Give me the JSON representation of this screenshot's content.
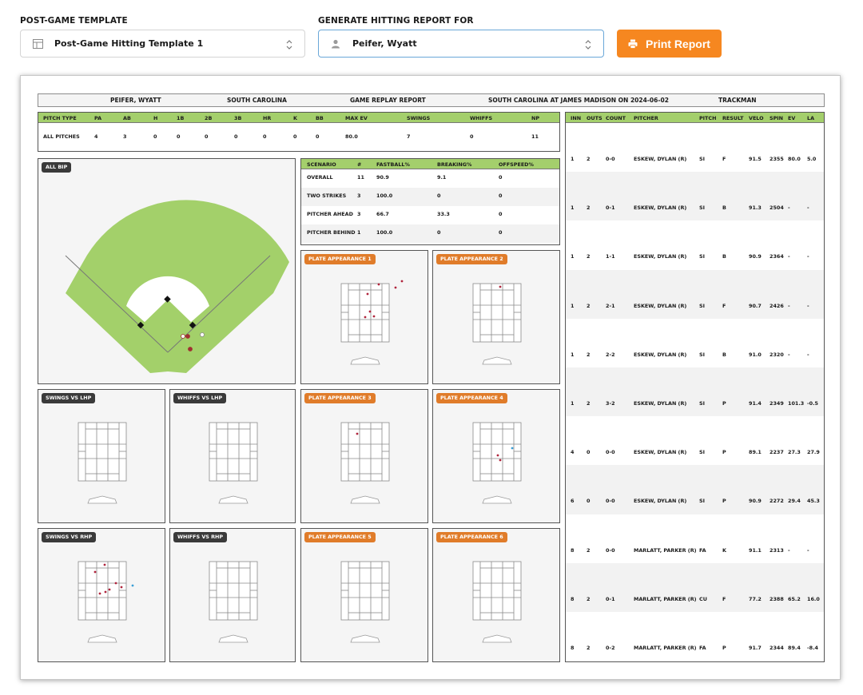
{
  "controls": {
    "template_label": "POST-GAME TEMPLATE",
    "template_value": "Post-Game Hitting Template 1",
    "report_for_label": "GENERATE HITTING REPORT FOR",
    "report_for_value": "Peifer, Wyatt",
    "print_label": "Print Report",
    "accent_color": "#f68720"
  },
  "header": {
    "player": "PEIFER, WYATT",
    "team": "SOUTH CAROLINA",
    "report": "GAME REPLAY REPORT",
    "game": "SOUTH CAROLINA AT JAMES MADISON ON 2024-06-02",
    "source": "TRACKMAN"
  },
  "stats": {
    "headers": [
      "PITCH TYPE",
      "PA",
      "AB",
      "H",
      "1B",
      "2B",
      "3B",
      "HR",
      "K",
      "BB",
      "MAX EV",
      "SWINGS",
      "WHIFFS",
      "NP"
    ],
    "row": [
      "ALL PITCHES",
      "4",
      "3",
      "0",
      "0",
      "0",
      "0",
      "0",
      "0",
      "0",
      "80.0",
      "7",
      "0",
      "11"
    ]
  },
  "scenario": {
    "headers": [
      "SCENARIO",
      "#",
      "FASTBALL%",
      "BREAKING%",
      "OFFSPEED%"
    ],
    "rows": [
      [
        "OVERALL",
        "11",
        "90.9",
        "9.1",
        "0"
      ],
      [
        "TWO STRIKES",
        "3",
        "100.0",
        "0",
        "0"
      ],
      [
        "PITCHER AHEAD",
        "3",
        "66.7",
        "33.3",
        "0"
      ],
      [
        "PITCHER BEHIND",
        "1",
        "100.0",
        "0",
        "0"
      ]
    ]
  },
  "panels": {
    "all_bip": "ALL BIP",
    "pa1": "PLATE APPEARANCE 1",
    "pa2": "PLATE APPEARANCE 2",
    "pa3": "PLATE APPEARANCE 3",
    "pa4": "PLATE APPEARANCE 4",
    "pa5": "PLATE APPEARANCE 5",
    "pa6": "PLATE APPEARANCE 6",
    "swings_lhp": "SWINGS VS LHP",
    "whiffs_lhp": "WHIFFS VS LHP",
    "swings_rhp": "SWINGS VS RHP",
    "whiffs_rhp": "WHIFFS VS RHP"
  },
  "pitches": {
    "headers": [
      "INN",
      "OUTS",
      "COUNT",
      "PITCHER",
      "PITCH",
      "RESULT",
      "VELO",
      "SPIN",
      "EV",
      "LA"
    ],
    "rows": [
      [
        "1",
        "2",
        "0-0",
        "ESKEW, DYLAN (R)",
        "SI",
        "F",
        "91.5",
        "2355",
        "80.0",
        "5.0"
      ],
      [
        "1",
        "2",
        "0-1",
        "ESKEW, DYLAN (R)",
        "SI",
        "B",
        "91.3",
        "2504",
        "-",
        "-"
      ],
      [
        "1",
        "2",
        "1-1",
        "ESKEW, DYLAN (R)",
        "SI",
        "B",
        "90.9",
        "2364",
        "-",
        "-"
      ],
      [
        "1",
        "2",
        "2-1",
        "ESKEW, DYLAN (R)",
        "SI",
        "F",
        "90.7",
        "2426",
        "-",
        "-"
      ],
      [
        "1",
        "2",
        "2-2",
        "ESKEW, DYLAN (R)",
        "SI",
        "B",
        "91.0",
        "2320",
        "-",
        "-"
      ],
      [
        "1",
        "2",
        "3-2",
        "ESKEW, DYLAN (R)",
        "SI",
        "P",
        "91.4",
        "2349",
        "101.3",
        "-0.5"
      ],
      [
        "4",
        "0",
        "0-0",
        "ESKEW, DYLAN (R)",
        "SI",
        "P",
        "89.1",
        "2237",
        "27.3",
        "27.9"
      ],
      [
        "6",
        "0",
        "0-0",
        "ESKEW, DYLAN (R)",
        "SI",
        "P",
        "90.9",
        "2272",
        "29.4",
        "45.3"
      ],
      [
        "8",
        "2",
        "0-0",
        "MARLATT, PARKER (R)",
        "FA",
        "K",
        "91.1",
        "2313",
        "-",
        "-"
      ],
      [
        "8",
        "2",
        "0-1",
        "MARLATT, PARKER (R)",
        "CU",
        "F",
        "77.2",
        "2388",
        "65.2",
        "16.0"
      ],
      [
        "8",
        "2",
        "0-2",
        "MARLATT, PARKER (R)",
        "FA",
        "P",
        "91.7",
        "2344",
        "89.4",
        "-8.4"
      ]
    ]
  },
  "colors": {
    "grass": "#a3d06a",
    "table_header": "#a4cf6c",
    "badge_orange": "#e07c2a",
    "dot_red": "#b0243c",
    "dot_blue": "#3a9fd6"
  }
}
